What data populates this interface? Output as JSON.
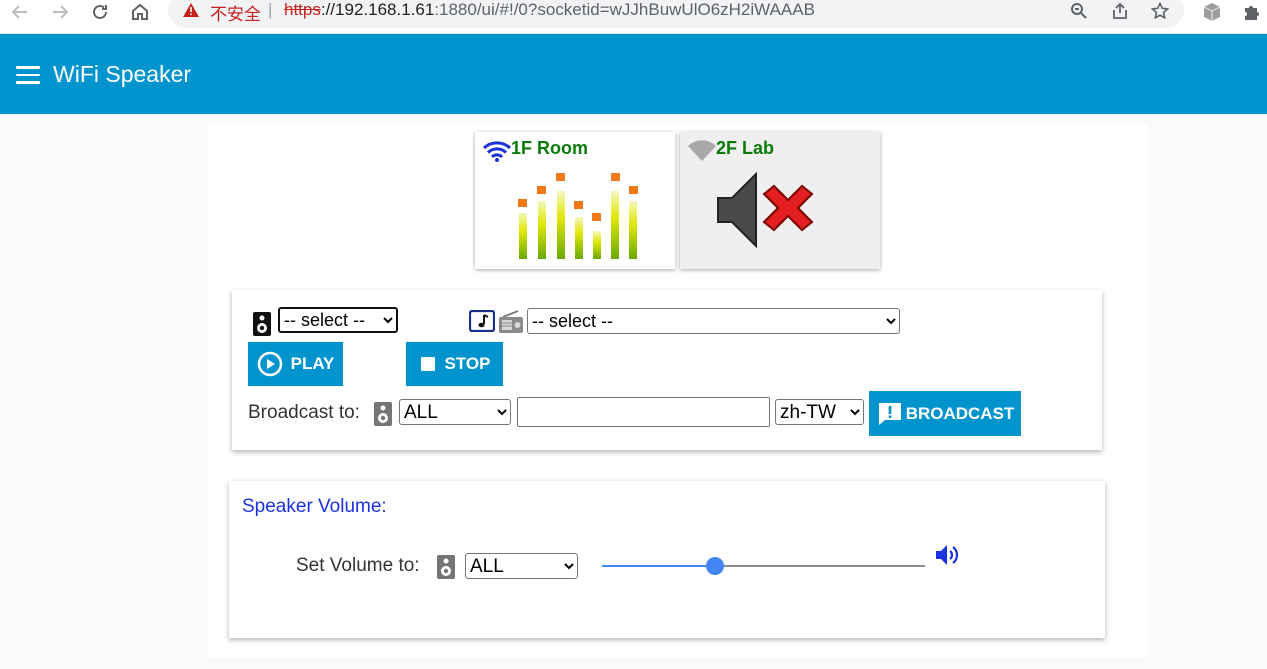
{
  "browser": {
    "insecure_label": "不安全",
    "separator": "|",
    "url_scheme": "https",
    "url_host": "://192.168.1.61",
    "url_rest": ":1880/ui/#!/0?socketid=wJJhBuwUlO6zH2iWAAAB"
  },
  "app": {
    "title": "WiFi Speaker",
    "accent_color": "#0094ce"
  },
  "speakers": [
    {
      "name": "1F Room",
      "status": "playing",
      "wifi": "connected",
      "icon": "equalizer-icon"
    },
    {
      "name": "2F Lab",
      "status": "muted",
      "wifi": "disconnected",
      "icon": "speaker-muted-icon"
    }
  ],
  "playback": {
    "speaker_select": {
      "value": "-- select --",
      "options": [
        "-- select --"
      ]
    },
    "source_select": {
      "value": "-- select --",
      "options": [
        "-- select --"
      ]
    },
    "play_label": "PLAY",
    "stop_label": "STOP"
  },
  "broadcast": {
    "label": "Broadcast to:",
    "target": {
      "value": "ALL",
      "options": [
        "ALL"
      ]
    },
    "message_value": "",
    "language": {
      "value": "zh-TW",
      "options": [
        "zh-TW"
      ]
    },
    "button_label": "BROADCAST"
  },
  "volume": {
    "title": "Speaker Volume:",
    "label": "Set Volume to:",
    "target": {
      "value": "ALL",
      "options": [
        "ALL"
      ]
    },
    "level": 0.35
  }
}
